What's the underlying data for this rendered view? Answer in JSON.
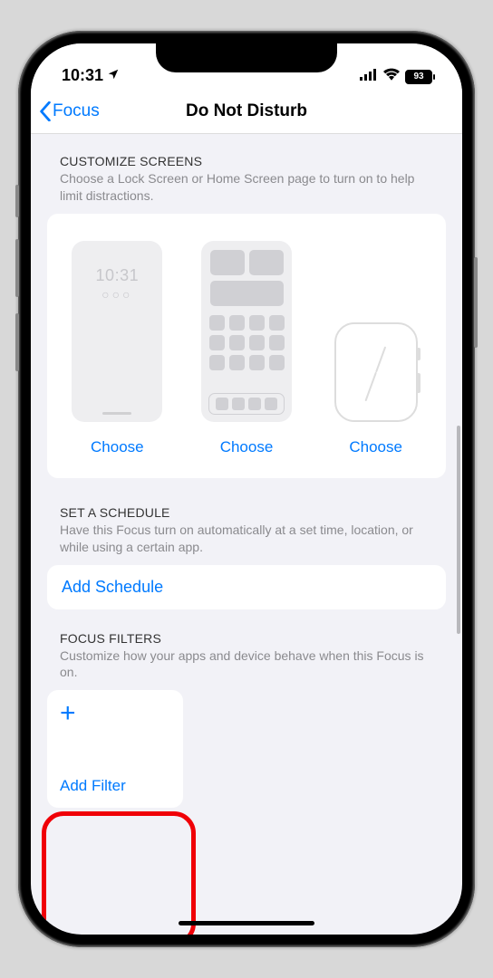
{
  "status": {
    "time": "10:31",
    "battery": "93"
  },
  "nav": {
    "back": "Focus",
    "title": "Do Not Disturb"
  },
  "customize": {
    "heading": "CUSTOMIZE SCREENS",
    "desc": "Choose a Lock Screen or Home Screen page to turn on to help limit distractions.",
    "choose": "Choose",
    "lock_time": "10:31",
    "lock_dots": "○○○"
  },
  "schedule": {
    "heading": "SET A SCHEDULE",
    "desc": "Have this Focus turn on automatically at a set time, location, or while using a certain app.",
    "add": "Add Schedule"
  },
  "filters": {
    "heading": "FOCUS FILTERS",
    "desc": "Customize how your apps and device behave when this Focus is on.",
    "add": "Add Filter"
  }
}
